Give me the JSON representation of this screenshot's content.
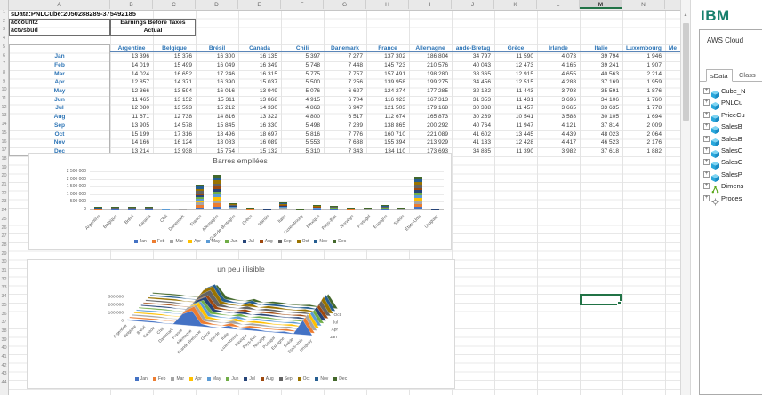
{
  "spreadsheet": {
    "row1_text": "sData:PNLCube:2050288289-375492185",
    "column_letters": [
      "A",
      "B",
      "C",
      "D",
      "E",
      "F",
      "G",
      "H",
      "I",
      "J",
      "K",
      "L",
      "M",
      "N"
    ],
    "selected_column": "M",
    "info_rows": [
      {
        "label": "account2",
        "value": "Earnings Before Taxes"
      },
      {
        "label": "actvsbud",
        "value": "Actual"
      }
    ],
    "country_headers": [
      "Argentine",
      "Belgique",
      "Brésil",
      "Canada",
      "Chili",
      "Danemark",
      "France",
      "Allemagne",
      "ande-Bretag",
      "Grèce",
      "Irlande",
      "Italie",
      "Luxembourg",
      "Me"
    ],
    "month_labels": [
      "Jan",
      "Feb",
      "Mar",
      "Apr",
      "May",
      "Jun",
      "Jul",
      "Aug",
      "Sep",
      "Oct",
      "Nov",
      "Dec"
    ]
  },
  "chart_data": [
    {
      "type": "bar",
      "stacked": true,
      "title": "Barres empilées",
      "categories": [
        "Argentine",
        "Belgique",
        "Brésil",
        "Canada",
        "Chili",
        "Danemark",
        "France",
        "Allemagne",
        "Grande-Bretagne",
        "Grèce",
        "Irlande",
        "Italie",
        "Luxembourg",
        "Mexique",
        "Pays-Bas",
        "Norvège",
        "Portugal",
        "Espagne",
        "Suède",
        "Etats-Unis",
        "Uruguay"
      ],
      "series": [
        {
          "name": "Jan",
          "color": "#4472C4",
          "values": [
            13396,
            15376,
            16300,
            16135,
            5397,
            7277,
            137302,
            186804,
            34797,
            11590,
            4073,
            39794,
            1946,
            25000,
            21500,
            10000,
            9200,
            23300,
            7500,
            183000,
            4200
          ]
        },
        {
          "name": "Feb",
          "color": "#ED7D31",
          "values": [
            14019,
            15499,
            16049,
            16349,
            5748,
            7448,
            145723,
            210576,
            40043,
            12473,
            4165,
            39241,
            1907,
            26000,
            22000,
            10300,
            9500,
            24000,
            7700,
            190000,
            4300
          ]
        },
        {
          "name": "Mar",
          "color": "#A5A5A5",
          "values": [
            14024,
            16652,
            17246,
            16315,
            5775,
            7757,
            157491,
            198280,
            38365,
            12915,
            4655,
            40563,
            2214,
            27000,
            22500,
            10600,
            9800,
            24800,
            7900,
            196000,
            4400
          ]
        },
        {
          "name": "Apr",
          "color": "#FFC000",
          "values": [
            12857,
            14371,
            16390,
            15037,
            5500,
            7256,
            139958,
            199275,
            34456,
            12515,
            4288,
            37169,
            1959,
            25500,
            21000,
            9900,
            9100,
            23000,
            7400,
            181000,
            4100
          ]
        },
        {
          "name": "May",
          "color": "#5B9BD5",
          "values": [
            12366,
            13594,
            16016,
            13949,
            5076,
            6627,
            124274,
            177285,
            32182,
            11443,
            3793,
            35591,
            1876,
            24000,
            20000,
            9400,
            8600,
            21800,
            7000,
            172000,
            3900
          ]
        },
        {
          "name": "Jun",
          "color": "#70AD47",
          "values": [
            11465,
            13152,
            15311,
            13868,
            4915,
            6704,
            116923,
            167313,
            31353,
            11431,
            3696,
            34106,
            1760,
            23000,
            19200,
            9000,
            8300,
            20900,
            6700,
            164000,
            3700
          ]
        },
        {
          "name": "Jul",
          "color": "#264478",
          "values": [
            12080,
            13593,
            15212,
            14330,
            4863,
            6947,
            121503,
            179168,
            30338,
            11457,
            3665,
            33635,
            1778,
            23800,
            19800,
            9300,
            8500,
            21500,
            6900,
            169000,
            3800
          ]
        },
        {
          "name": "Aug",
          "color": "#9E480E",
          "values": [
            11671,
            12738,
            14816,
            13322,
            4800,
            6517,
            112674,
            165873,
            30269,
            10541,
            3588,
            30105,
            1694,
            22500,
            18800,
            8800,
            8100,
            20400,
            6500,
            160000,
            3600
          ]
        },
        {
          "name": "Sep",
          "color": "#636363",
          "values": [
            13905,
            14578,
            15845,
            16330,
            5498,
            7289,
            138865,
            200292,
            40764,
            11947,
            4121,
            37814,
            2009,
            25800,
            21300,
            10100,
            9300,
            23500,
            7600,
            184000,
            4200
          ]
        },
        {
          "name": "Oct",
          "color": "#997300",
          "values": [
            15199,
            17316,
            18496,
            18697,
            5816,
            7776,
            160710,
            221089,
            41602,
            13445,
            4439,
            48023,
            2064,
            28000,
            23200,
            11000,
            10100,
            25600,
            8200,
            201000,
            4600
          ]
        },
        {
          "name": "Nov",
          "color": "#255E91",
          "values": [
            14166,
            16124,
            18083,
            16089,
            5553,
            7638,
            155394,
            213929,
            41133,
            12428,
            4417,
            46523,
            2176,
            27200,
            22600,
            10700,
            9800,
            24900,
            8000,
            195000,
            4500
          ]
        },
        {
          "name": "Dec",
          "color": "#43682B",
          "values": [
            13214,
            13938,
            15754,
            15132,
            5310,
            7343,
            134110,
            173693,
            34835,
            11390,
            3982,
            37618,
            1882,
            24500,
            20300,
            9600,
            8800,
            22100,
            7100,
            174000,
            4000
          ]
        }
      ],
      "ytick_labels": [
        "0",
        "500 000",
        "1 000 000",
        "1 500 000",
        "2 000 000",
        "2 500 000"
      ],
      "ylim": [
        0,
        2500000
      ],
      "legend_position": "bottom",
      "grid": true
    },
    {
      "type": "area",
      "three_d": true,
      "title": "un peu illisible",
      "series_source": 0,
      "ytick_labels": [
        "0",
        "100 000",
        "200 000",
        "300 000"
      ],
      "ylim": [
        0,
        300000
      ],
      "depth_axis_labels": [
        "Jan",
        "Apr",
        "Jul",
        "Oct"
      ],
      "legend_position": "bottom"
    }
  ],
  "right_panel": {
    "logo": "IBM",
    "header": "AWS Cloud",
    "tabs": [
      {
        "label": "sData",
        "active": true
      },
      {
        "label": "Class",
        "active": false
      }
    ],
    "tree": [
      {
        "label": "Cube_N",
        "icon": "cube-icon"
      },
      {
        "label": "PNLCu",
        "icon": "cube-icon"
      },
      {
        "label": "PriceCu",
        "icon": "cube-icon"
      },
      {
        "label": "SalesB",
        "icon": "cube-icon"
      },
      {
        "label": "SalesB",
        "icon": "cube-icon"
      },
      {
        "label": "SalesC",
        "icon": "cube-icon"
      },
      {
        "label": "SalesC",
        "icon": "cube-icon"
      },
      {
        "label": "SalesP",
        "icon": "cube-icon"
      },
      {
        "label": "Dimens",
        "icon": "dimension-icon"
      },
      {
        "label": "Proces",
        "icon": "process-icon"
      }
    ]
  },
  "colors": {
    "accent_green": "#217346",
    "header_blue": "#2e75b6",
    "ibm_teal": "#17806d"
  }
}
